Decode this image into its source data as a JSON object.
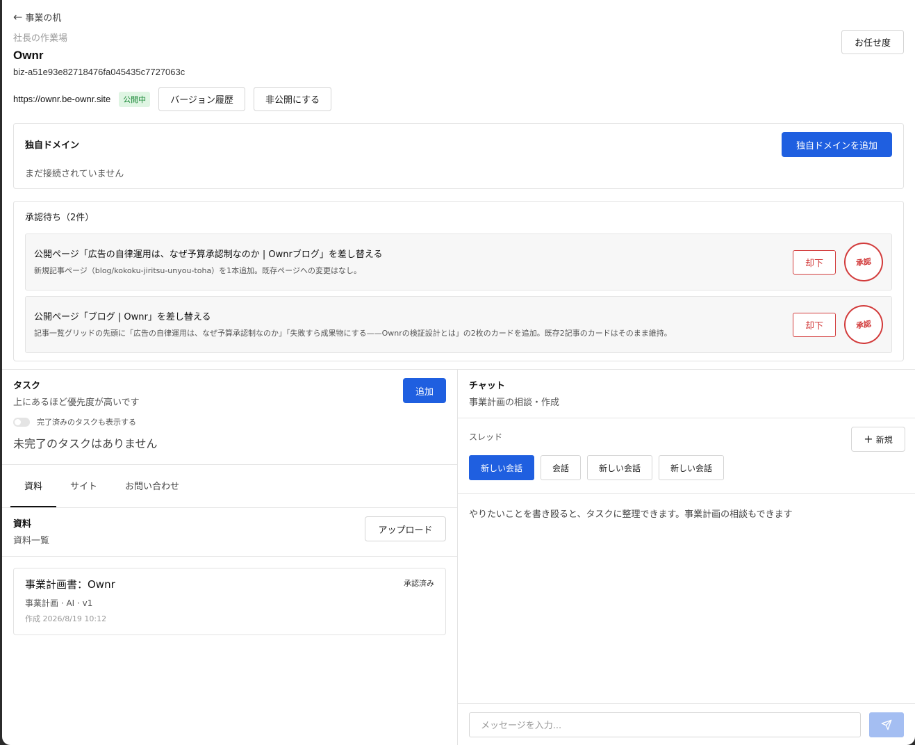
{
  "header": {
    "back_label": "事業の机",
    "subtitle": "社長の作業場",
    "title": "Ownr",
    "biz_id": "biz-a51e93e82718476fa045435c7727063c",
    "omakase_label": "お任せ度",
    "url": "https://ownr.be-ownr.site",
    "status_badge": "公開中",
    "version_history_label": "バージョン履歴",
    "unpublish_label": "非公開にする"
  },
  "domain": {
    "heading": "独自ドメイン",
    "status": "まだ接続されていません",
    "add_label": "独自ドメインを追加"
  },
  "approvals": {
    "heading": "承認待ち（2件）",
    "items": [
      {
        "title": "公開ページ「広告の自律運用は、なぜ予算承認制なのか | Ownrブログ」を差し替える",
        "desc": "新規記事ページ（blog/kokoku-jiritsu-unyou-toha）を1本追加。既存ページへの変更はなし。",
        "reject_label": "却下",
        "approve_label": "承認"
      },
      {
        "title": "公開ページ「ブログ | Ownr」を差し替える",
        "desc": "記事一覧グリッドの先頭に「広告の自律運用は、なぜ予算承認制なのか」「失敗すら成果物にする——Ownrの検証設計とは」の2枚のカードを追加。既存2記事のカードはそのまま維持。",
        "reject_label": "却下",
        "approve_label": "承認"
      }
    ]
  },
  "tasks": {
    "heading": "タスク",
    "subheading": "上にあるほど優先度が高いです",
    "add_label": "追加",
    "toggle_label": "完了済みのタスクも表示する",
    "toggle_on": false,
    "empty": "未完了のタスクはありません"
  },
  "tabs": [
    {
      "label": "資料",
      "active": true
    },
    {
      "label": "サイト",
      "active": false
    },
    {
      "label": "お問い合わせ",
      "active": false
    }
  ],
  "docs": {
    "heading": "資料",
    "subheading": "資料一覧",
    "upload_label": "アップロード",
    "items": [
      {
        "title": "事業計画書：Ownr",
        "meta": "事業計画 · AI · v1",
        "date": "作成 2026/8/19 10:12",
        "status": "承認済み"
      }
    ]
  },
  "chat": {
    "heading": "チャット",
    "subheading": "事業計画の相談・作成",
    "thread_label": "スレッド",
    "new_label": "新規",
    "threads": [
      {
        "label": "新しい会話",
        "active": true
      },
      {
        "label": "会話",
        "active": false
      },
      {
        "label": "新しい会話",
        "active": false
      },
      {
        "label": "新しい会話",
        "active": false
      }
    ],
    "hint": "やりたいことを書き殴ると、タスクに整理できます。事業計画の相談もできます",
    "input_placeholder": "メッセージを入力..."
  },
  "colors": {
    "primary": "#1f5fe0",
    "danger": "#d23b3b",
    "published_bg": "#dff5e3",
    "published_text": "#1e8a3a",
    "send_disabled": "#a4bef2"
  }
}
